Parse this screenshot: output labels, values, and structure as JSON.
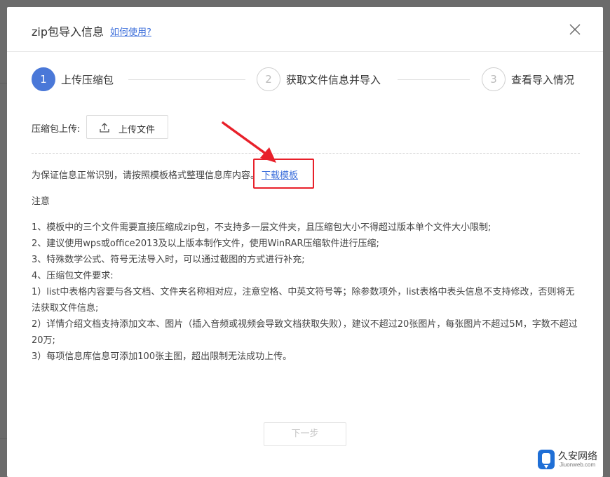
{
  "dialog": {
    "title": "zip包导入信息",
    "help_link": "如何使用?"
  },
  "steps": [
    {
      "number": "1",
      "label": "上传压缩包",
      "state": "active"
    },
    {
      "number": "2",
      "label": "获取文件信息并导入",
      "state": "inactive"
    },
    {
      "number": "3",
      "label": "查看导入情况",
      "state": "inactive"
    }
  ],
  "upload": {
    "label": "压缩包上传:",
    "button_label": "上传文件"
  },
  "hint": {
    "text": "为保证信息正常识别，请按照模板格式整理信息库内容。",
    "download_link": "下载模板"
  },
  "notes": {
    "title": "注意",
    "items": [
      "1、模板中的三个文件需要直接压缩成zip包，不支持多一层文件夹，且压缩包大小不得超过版本单个文件大小限制;",
      "2、建议使用wps或office2013及以上版本制作文件，使用WinRAR压缩软件进行压缩;",
      "3、特殊数学公式、符号无法导入时，可以通过截图的方式进行补充;",
      "4、压缩包文件要求:",
      "1）list中表格内容要与各文档、文件夹名称相对应，注意空格、中英文符号等；除参数项外，list表格中表头信息不支持修改，否则将无法获取文件信息;",
      "2）详情介绍文档支持添加文本、图片（插入音频或视频会导致文档获取失败），建议不超过20张图片，每张图片不超过5M，字数不超过20万;",
      "3）每项信息库信息可添加100张主图，超出限制无法成功上传。"
    ]
  },
  "footer": {
    "next_button": "下一步"
  },
  "watermark": {
    "name": "久安网络",
    "url": "Jiuonweb.com"
  },
  "colors": {
    "primary": "#4a78d8",
    "link": "#3d6fdb",
    "annotation": "#e8202a",
    "backdrop": "#6b6b6b"
  },
  "icons": {
    "close": "close-icon",
    "upload": "upload-icon",
    "annotation_arrow": "red-arrow"
  }
}
